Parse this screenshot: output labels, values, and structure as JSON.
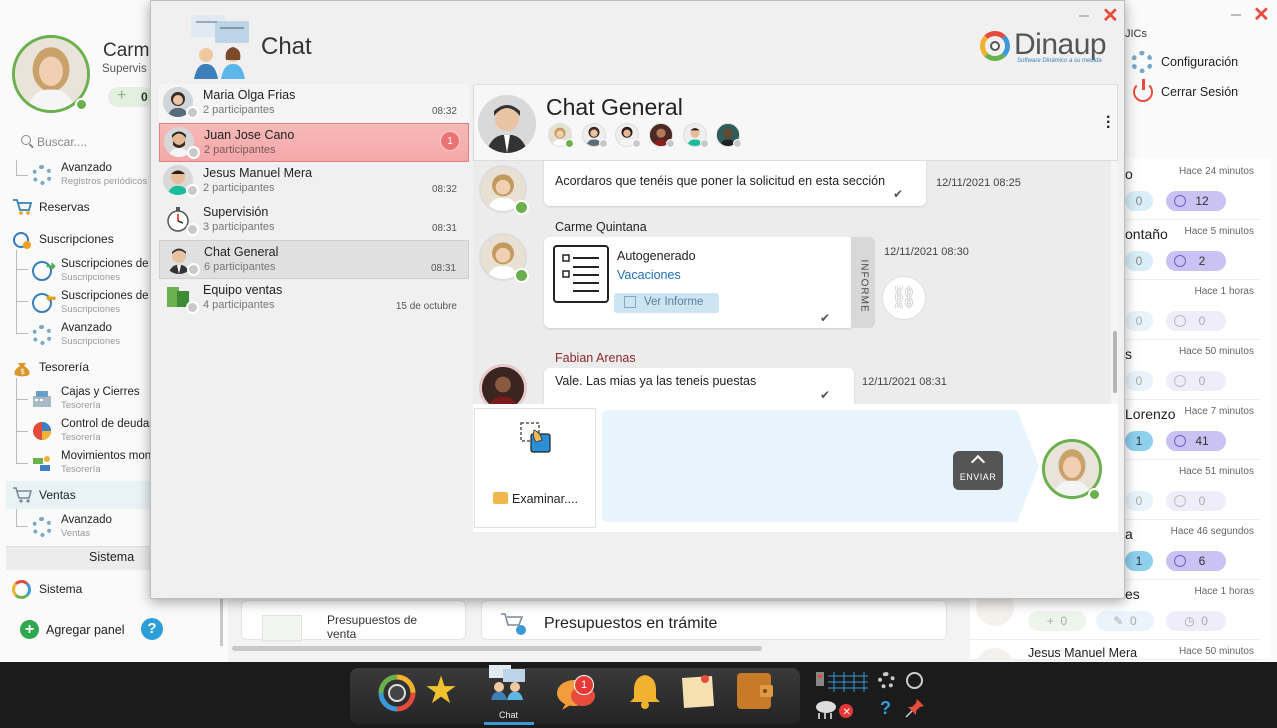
{
  "left_panel": {
    "user_name": "Carm",
    "user_role": "Supervis",
    "counter": "0",
    "search_placeholder": "Buscar....",
    "items": [
      {
        "label": "Avanzado",
        "sub": "Registros periódicos"
      },
      {
        "label": "Reservas"
      },
      {
        "label": "Suscripciones"
      },
      {
        "label": "Suscripciones de",
        "sub": "Suscripciones"
      },
      {
        "label": "Suscripciones de",
        "sub": "Suscripciones"
      },
      {
        "label": "Avanzado",
        "sub": "Suscripciones"
      },
      {
        "label": "Tesorería"
      },
      {
        "label": "Cajas y Cierres",
        "sub": "Tesorería"
      },
      {
        "label": "Control de deudas",
        "sub": "Tesorería"
      },
      {
        "label": "Movimientos mon",
        "sub": "Tesorería"
      },
      {
        "label": "Ventas"
      },
      {
        "label": "Avanzado",
        "sub": "Ventas"
      }
    ],
    "section_title": "Sistema",
    "sistema_label": "Sistema",
    "add_panel_label": "Agregar panel"
  },
  "right_panel": {
    "header_fragment": "JICs",
    "config_label": "Configuración",
    "logout_label": "Cerrar Sesión",
    "cards": [
      {
        "name": "o",
        "time": "Hace 24 minutos",
        "left": "0",
        "right": "12"
      },
      {
        "name": "ontaño",
        "time": "Hace 5 minutos",
        "left": "0",
        "right": "2"
      },
      {
        "name": "",
        "time": "Hace 1 horas",
        "left": "0",
        "right": "0"
      },
      {
        "name": "s",
        "time": "Hace 50 minutos",
        "left": "0",
        "right": "0"
      },
      {
        "name": "Lorenzo",
        "time": "Hace 7 minutos",
        "left": "1",
        "right": "41"
      },
      {
        "name": "",
        "time": "Hace 51 minutos",
        "left": "0",
        "right": "0"
      },
      {
        "name": "a",
        "time": "Hace 46 segundos",
        "left": "1",
        "right": "6"
      },
      {
        "name": "es",
        "time": "Hace 1 horas",
        "left": "0",
        "right": "0"
      },
      {
        "name": "Jesus Manuel Mera",
        "time": "Hace 50 minutos"
      }
    ]
  },
  "bottom": {
    "card1_title": "Presupuestos de venta",
    "card2_title": "Presupuestos en trámite"
  },
  "chat": {
    "title": "Chat",
    "brand": "Dinaup",
    "brand_tagline": "Software Dinámico a su medida",
    "conversations": [
      {
        "name": "Maria Olga Frias",
        "sub": "2 participantes",
        "time": "08:32"
      },
      {
        "name": "Juan Jose Cano",
        "sub": "2 participantes",
        "badge": "1"
      },
      {
        "name": "Jesus Manuel Mera",
        "sub": "2 participantes",
        "time": "08:32"
      },
      {
        "name": "Supervisión",
        "sub": "3 participantes",
        "time": "08:31"
      },
      {
        "name": "Chat General",
        "sub": "6 participantes",
        "time": "08:31"
      },
      {
        "name": "Equipo ventas",
        "sub": "4 participantes",
        "time": "15 de octubre"
      }
    ],
    "active_title": "Chat General",
    "messages": [
      {
        "text": "Acordaros que tenéis que poner la solicitud en esta sección",
        "time": "12/11/2021 08:25"
      },
      {
        "author": "Carme Quintana",
        "doc_title": "Autogenerado",
        "doc_link": "Vacaciones",
        "doc_button": "Ver Informe",
        "side_label": "INFORME",
        "time": "12/11/2021 08:30"
      },
      {
        "author": "Fabian Arenas",
        "text": "Vale. Las mias ya las teneis puestas",
        "time": "12/11/2021 08:31"
      }
    ],
    "browse_label": "Examinar....",
    "send_label": "ENVIAR"
  },
  "taskbar": {
    "chat_label": "Chat",
    "notification_badge": "1"
  },
  "colors": {
    "accent_green": "#6ab04c",
    "selected_red": "#f4a8a8",
    "pill_blue": "#8fd0ee",
    "pill_purple": "#c9c2f2",
    "input_blue": "#e8f4fd"
  }
}
